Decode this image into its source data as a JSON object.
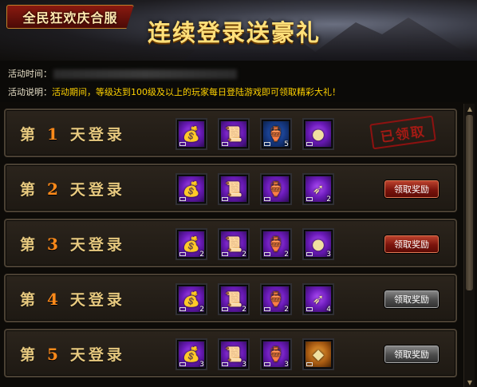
{
  "banner": {
    "tag": "全民狂欢庆合服",
    "title": "连续登录送豪礼"
  },
  "info": {
    "time_label": "活动时间：",
    "desc_label": "活动说明：",
    "desc_text": "活动期间，等级达到100级及以上的玩家每日登陆游戏即可领取精彩大礼！"
  },
  "rows": [
    {
      "prefix": "第",
      "num": "1",
      "suffix": "天登录",
      "status": "claimed",
      "status_label": "已领取",
      "items": [
        {
          "icon": "gold-bag-icon",
          "bg": "purple",
          "count": ""
        },
        {
          "icon": "scroll-icon",
          "bg": "purple",
          "count": ""
        },
        {
          "icon": "potion-icon",
          "bg": "blue",
          "count": "5"
        },
        {
          "icon": "orb-icon",
          "bg": "purple",
          "count": ""
        }
      ]
    },
    {
      "prefix": "第",
      "num": "2",
      "suffix": "天登录",
      "status": "available",
      "button_label": "领取奖励",
      "items": [
        {
          "icon": "gold-bag-icon",
          "bg": "purple",
          "count": ""
        },
        {
          "icon": "scroll-icon",
          "bg": "purple",
          "count": ""
        },
        {
          "icon": "potion-icon",
          "bg": "purple",
          "count": ""
        },
        {
          "icon": "feather-icon",
          "bg": "purple",
          "count": "2"
        }
      ]
    },
    {
      "prefix": "第",
      "num": "3",
      "suffix": "天登录",
      "status": "available",
      "button_label": "领取奖励",
      "items": [
        {
          "icon": "gold-bag-icon",
          "bg": "purple",
          "count": "2"
        },
        {
          "icon": "scroll-icon",
          "bg": "purple",
          "count": "2"
        },
        {
          "icon": "potion-icon",
          "bg": "purple",
          "count": "2"
        },
        {
          "icon": "orb-icon",
          "bg": "purple",
          "count": "3"
        }
      ]
    },
    {
      "prefix": "第",
      "num": "4",
      "suffix": "天登录",
      "status": "locked",
      "button_label": "领取奖励",
      "items": [
        {
          "icon": "gold-bag-icon",
          "bg": "purple",
          "count": "2"
        },
        {
          "icon": "scroll-icon",
          "bg": "purple",
          "count": "2"
        },
        {
          "icon": "potion-icon",
          "bg": "purple",
          "count": "2"
        },
        {
          "icon": "feather-icon",
          "bg": "purple",
          "count": "4"
        }
      ]
    },
    {
      "prefix": "第",
      "num": "5",
      "suffix": "天登录",
      "status": "locked",
      "button_label": "领取奖励",
      "items": [
        {
          "icon": "gold-bag-icon",
          "bg": "purple",
          "count": "3"
        },
        {
          "icon": "scroll-icon",
          "bg": "purple",
          "count": "3"
        },
        {
          "icon": "potion-icon",
          "bg": "purple",
          "count": "3"
        },
        {
          "icon": "ore-icon",
          "bg": "gold",
          "count": ""
        }
      ]
    }
  ],
  "icons": {
    "gold-bag-icon": "💰",
    "scroll-icon": "📜",
    "potion-icon": "🏺",
    "orb-icon": "●",
    "feather-icon": "➶",
    "ore-icon": "◆"
  },
  "colors": {
    "accent_gold": "#ffd200",
    "day_number": "#ff8a1a",
    "claimed_stamp": "#b81a14"
  }
}
